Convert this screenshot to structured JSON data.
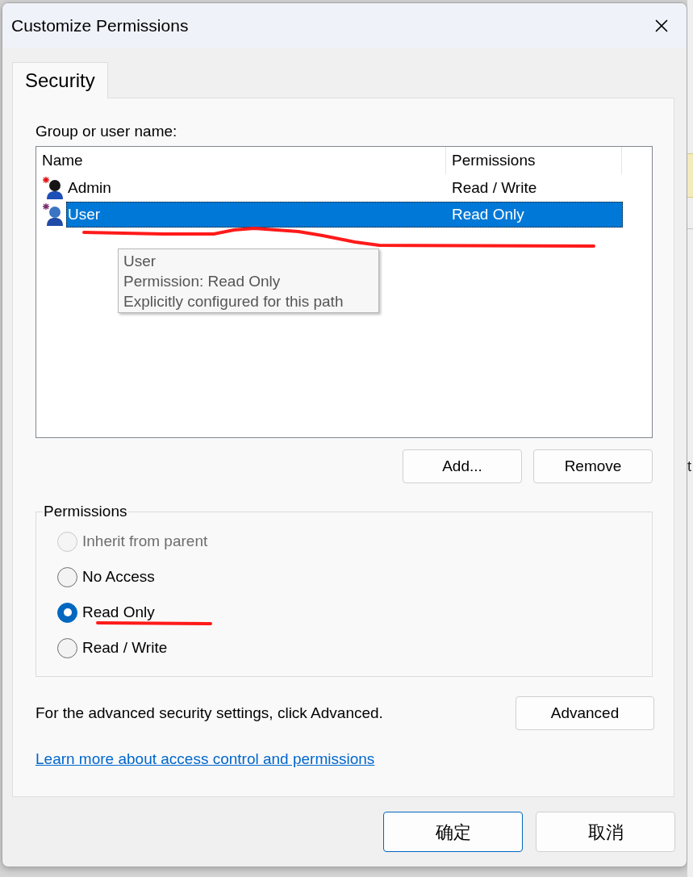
{
  "window": {
    "title": "Customize Permissions"
  },
  "tabs": [
    {
      "label": "Security",
      "selected": true
    }
  ],
  "user_list": {
    "label": "Group or user name:",
    "columns": [
      "Name",
      "Permissions"
    ],
    "rows": [
      {
        "kind": "admin",
        "name": "Admin",
        "permission": "Read / Write",
        "selected": false
      },
      {
        "kind": "user",
        "name": "User",
        "permission": "Read Only",
        "selected": true
      }
    ]
  },
  "tooltip": {
    "lines": [
      "User",
      "Permission: Read Only",
      "Explicitly configured for this path"
    ]
  },
  "list_buttons": [
    "Add...",
    "Remove"
  ],
  "permissions": {
    "label": "Permissions",
    "options": [
      {
        "label": "Inherit from parent",
        "selected": false,
        "disabled": true
      },
      {
        "label": "No Access",
        "selected": false,
        "disabled": false
      },
      {
        "label": "Read Only",
        "selected": true,
        "disabled": false
      },
      {
        "label": "Read / Write",
        "selected": false,
        "disabled": false
      }
    ]
  },
  "advanced": {
    "text": "For the advanced security settings, click Advanced.",
    "button": "Advanced"
  },
  "link": "Learn more about access control and permissions",
  "buttons": [
    {
      "label": "确定",
      "default": true
    },
    {
      "label": "取消",
      "default": false
    }
  ],
  "background": {
    "text": "t"
  }
}
